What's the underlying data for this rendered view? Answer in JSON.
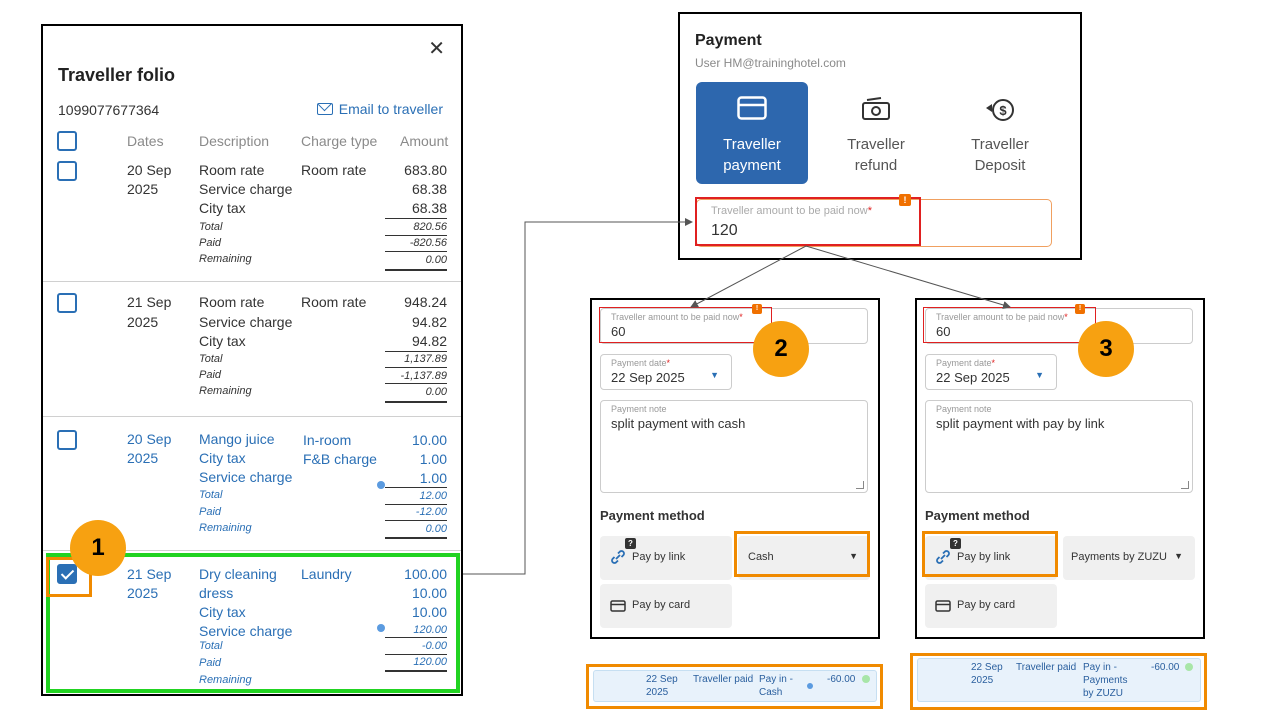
{
  "folio": {
    "title": "Traveller folio",
    "folio_id": "1099077677364",
    "email_label": "Email to traveller",
    "close_label": "✕",
    "headers": {
      "dates": "Dates",
      "description": "Description",
      "charge_type": "Charge type",
      "amount": "Amount"
    },
    "groups": [
      {
        "date1": "20 Sep",
        "date2": "2025",
        "blue": false,
        "items": [
          {
            "desc": "Room rate",
            "type": "Room rate",
            "amount": "683.80"
          },
          {
            "desc": "Service charge",
            "type": "",
            "amount": "68.38"
          },
          {
            "desc": "City tax",
            "type": "",
            "amount": "68.38"
          }
        ],
        "total": "820.56",
        "paid": "-820.56",
        "remaining": "0.00"
      },
      {
        "date1": "21 Sep",
        "date2": "2025",
        "blue": false,
        "items": [
          {
            "desc": "Room rate",
            "type": "Room rate",
            "amount": "948.24"
          },
          {
            "desc": "Service charge",
            "type": "",
            "amount": "94.82"
          },
          {
            "desc": "City tax",
            "type": "",
            "amount": "94.82"
          }
        ],
        "total": "1,137.89",
        "paid": "-1,137.89",
        "remaining": "0.00"
      },
      {
        "date1": "20 Sep",
        "date2": "2025",
        "blue": true,
        "items": [
          {
            "desc": "Mango juice",
            "type": "In-room",
            "amount": "10.00"
          },
          {
            "desc": "City tax",
            "type": "F&B charge",
            "amount": "1.00"
          },
          {
            "desc": "Service charge",
            "type": "",
            "amount": "1.00"
          }
        ],
        "total": "12.00",
        "paid": "-12.00",
        "remaining": "0.00"
      },
      {
        "date1": "21 Sep",
        "date2": "2025",
        "blue": true,
        "items": [
          {
            "desc": "Dry cleaning",
            "type": "Laundry",
            "amount": "100.00"
          },
          {
            "desc": "dress",
            "type": "",
            "amount": "10.00"
          },
          {
            "desc": "City tax",
            "type": "",
            "amount": "10.00"
          },
          {
            "desc": "Service charge",
            "type": "",
            "amount": "120.00"
          }
        ],
        "total": "-0.00",
        "paid": "120.00",
        "remaining": ""
      }
    ],
    "labels": {
      "total": "Total",
      "paid": "Paid",
      "remaining": "Remaining"
    }
  },
  "payment": {
    "title": "Payment",
    "user": "User HM@traininghotel.com",
    "tabs": [
      {
        "line1": "Traveller",
        "line2": "payment"
      },
      {
        "line1": "Traveller",
        "line2": "refund"
      },
      {
        "line1": "Traveller",
        "line2": "Deposit"
      }
    ],
    "amount_label": "Traveller amount to be paid now",
    "amount_value": "120",
    "required": "*",
    "warn": "!"
  },
  "splits": [
    {
      "amount_label": "Traveller amount to be paid now",
      "amount_value": "60",
      "date_label": "Payment date",
      "date_value": "22 Sep 2025",
      "note_label": "Payment note",
      "note_value": "split payment with cash",
      "method_title": "Payment method",
      "pay_by_link": "Pay by link",
      "second_option": "Cash",
      "pay_by_card": "Pay by card",
      "badge": "2"
    },
    {
      "amount_label": "Traveller amount to be paid now",
      "amount_value": "60",
      "date_label": "Payment date",
      "date_value": "22 Sep 2025",
      "note_label": "Payment note",
      "note_value": "split payment with pay by link",
      "method_title": "Payment method",
      "pay_by_link": "Pay by link",
      "second_option": "Payments by ZUZU",
      "pay_by_card": "Pay by card",
      "badge": "3"
    }
  ],
  "results": [
    {
      "date1": "22 Sep",
      "date2": "2025",
      "who": "Traveller paid",
      "pay1": "Pay in -",
      "pay2": "Cash",
      "pay3": "",
      "amount": "-60.00"
    },
    {
      "date1": "22 Sep",
      "date2": "2025",
      "who": "Traveller paid",
      "pay1": "Pay in -",
      "pay2": "Payments",
      "pay3": "by ZUZU",
      "amount": "-60.00"
    }
  ],
  "badge1": "1",
  "qmark": "?",
  "colors": {
    "accent": "#2d67ae",
    "highlight_orange": "#f08a00",
    "highlight_green": "#21d321",
    "highlight_red": "#e02020",
    "badge": "#f7a111"
  }
}
